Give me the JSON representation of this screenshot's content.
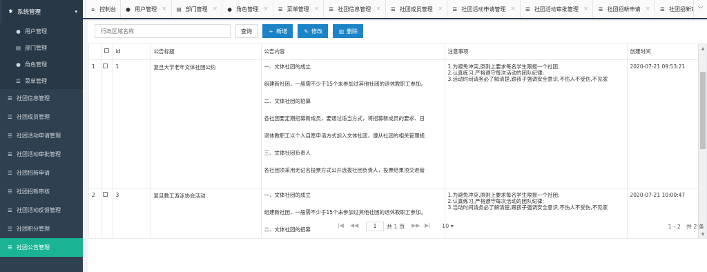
{
  "sidebar": {
    "group_label": "系统管理",
    "sub_items": [
      {
        "label": "用户管理",
        "icon": "user-icon"
      },
      {
        "label": "部门管理",
        "icon": "file-icon"
      },
      {
        "label": "角色管理",
        "icon": "user-icon"
      },
      {
        "label": "菜单管理",
        "icon": "list-icon"
      }
    ],
    "items": [
      {
        "label": "社团信息管理",
        "active": false
      },
      {
        "label": "社团成员管理",
        "active": false
      },
      {
        "label": "社团活动申请管理",
        "active": false
      },
      {
        "label": "社团活动审批管理",
        "active": false
      },
      {
        "label": "社团招新申请",
        "active": false
      },
      {
        "label": "社团招新审核",
        "active": false
      },
      {
        "label": "社团活动反馈管理",
        "active": false
      },
      {
        "label": "社团积分管理",
        "active": false
      },
      {
        "label": "社团公告管理",
        "active": true
      }
    ]
  },
  "tabs": [
    {
      "label": "控制台",
      "icon": "home-icon",
      "closable": false
    },
    {
      "label": "用户管理",
      "icon": "user-icon",
      "closable": true
    },
    {
      "label": "部门管理",
      "icon": "file-icon",
      "closable": true
    },
    {
      "label": "角色管理",
      "icon": "user-icon",
      "closable": true
    },
    {
      "label": "菜单管理",
      "icon": "list-icon",
      "closable": true
    },
    {
      "label": "社团信息管理",
      "icon": "list-icon",
      "closable": true
    },
    {
      "label": "社团成员管理",
      "icon": "list-icon",
      "closable": true
    },
    {
      "label": "社团活动申请管理",
      "icon": "list-icon",
      "closable": true
    },
    {
      "label": "社团活动审批管理",
      "icon": "list-icon",
      "closable": true
    },
    {
      "label": "社团招新申请",
      "icon": "list-icon",
      "closable": true
    },
    {
      "label": "社团招新审核",
      "icon": "list-icon",
      "closable": false
    }
  ],
  "toolbar": {
    "search_placeholder": "行政区域名称",
    "query_label": "查询",
    "add_label": "新增",
    "edit_label": "修改",
    "delete_label": "删除"
  },
  "table": {
    "headers": {
      "id": "id",
      "title": "公告标题",
      "content": "公告内容",
      "notes": "注意事项",
      "created": "创建时间"
    },
    "rows": [
      {
        "index": "1",
        "id": "1",
        "title": "复旦大学老年文体社团公约",
        "content": [
          "一、文体社团的成立",
          "组建新社团，一般需不少于15个未参加过其他社团的退休教职工参加。",
          "二、文体社团的招募",
          "各社团要定期招募新成员，要通过适当方式，将招募新成员的要求、日",
          "退休教职工以个人自愿申请方式加入文体社团，遵从社团的相关管理规",
          "三、文体社团负责人",
          "各社团须采用无记名投票方式公开选拔社团负责人，投票结果须交退管"
        ],
        "notes": [
          "1.为避免冲突,原则上要求每名学生限报一个社团;",
          "2.认真练习,严格遵守每次活动的团队纪律;",
          "3.活动时间请务必了解清楚,跟孩子强调安全意识,不伤人不受伤,不见家"
        ],
        "created": "2020-07-21 09:53:21"
      },
      {
        "index": "2",
        "id": "3",
        "title": "复旦教工游泳协会活动",
        "content": [
          "一、文体社团的成立",
          "组建新社团，一般需不少于15个未参加过其他社团的退休教职工参加。",
          "二、文体社团的招募"
        ],
        "notes": [
          "1.为避免冲突,原则上要求每名学生限报一个社团;",
          "2.认真练习,严格遵守每次活动的团队纪律;",
          "3.活动时间请务必了解清楚,跟孩子强调安全意识,不伤人不受伤,不见家"
        ],
        "created": "2020-07-21 10:00:47"
      }
    ]
  },
  "pagination": {
    "current_page": "1",
    "total_pages": "共 1 页",
    "page_size": "10",
    "summary": "1 - 2　共 2 条"
  },
  "colors": {
    "sidebar": "#2f4050",
    "active": "#1ab394",
    "primary": "#1c84c6"
  }
}
